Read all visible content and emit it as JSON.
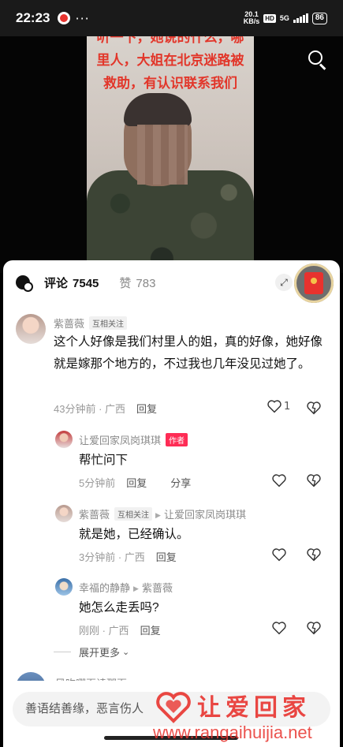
{
  "status_bar": {
    "time": "22:23",
    "more": "···",
    "speed_value": "20.1",
    "speed_unit": "KB/s",
    "hd": "HD",
    "network": "5G",
    "battery": "86"
  },
  "video": {
    "caption": "听一下，她说的什么，哪里人，大姐在北京迷路被救助，有认识联系我们",
    "search_icon": "search-icon"
  },
  "header": {
    "comments_label": "评论",
    "comments_count": "7545",
    "likes_label": "赞",
    "likes_count": "783"
  },
  "comments": [
    {
      "name": "紫蔷薇",
      "badge": "互相关注",
      "text": "这个人好像是我们村里人的姐，真的好像，她好像就是嫁那个地方的，不过我也几年没见过她了。",
      "time": "43分钟前 · 广西",
      "reply": "回复",
      "likes": "1"
    }
  ],
  "replies": [
    {
      "name": "让爱回家凤岗琪琪",
      "badge": "作者",
      "text": "帮忙问下",
      "time": "5分钟前",
      "reply": "回复",
      "share": "分享"
    },
    {
      "name": "紫蔷薇",
      "badge": "互相关注",
      "reply_to": "让爱回家凤岗琪琪",
      "text": "就是她，已经确认。",
      "time": "3分钟前 · 广西",
      "reply": "回复"
    },
    {
      "name": "幸福的静静",
      "reply_to": "紫蔷薇",
      "text": "她怎么走丢吗?",
      "time": "刚刚 · 广西",
      "reply": "回复"
    }
  ],
  "expand_more": "展开更多",
  "next_comment_name": "风吹哪页读那页",
  "input": {
    "placeholder": "善语结善缘，恶言伤人"
  },
  "watermark": {
    "title": "让爱回家",
    "url": "www.rangaihuijia.net"
  },
  "colors": {
    "author_badge": "#fe2c55",
    "caption": "#e2362a",
    "watermark": "#e8342f"
  }
}
